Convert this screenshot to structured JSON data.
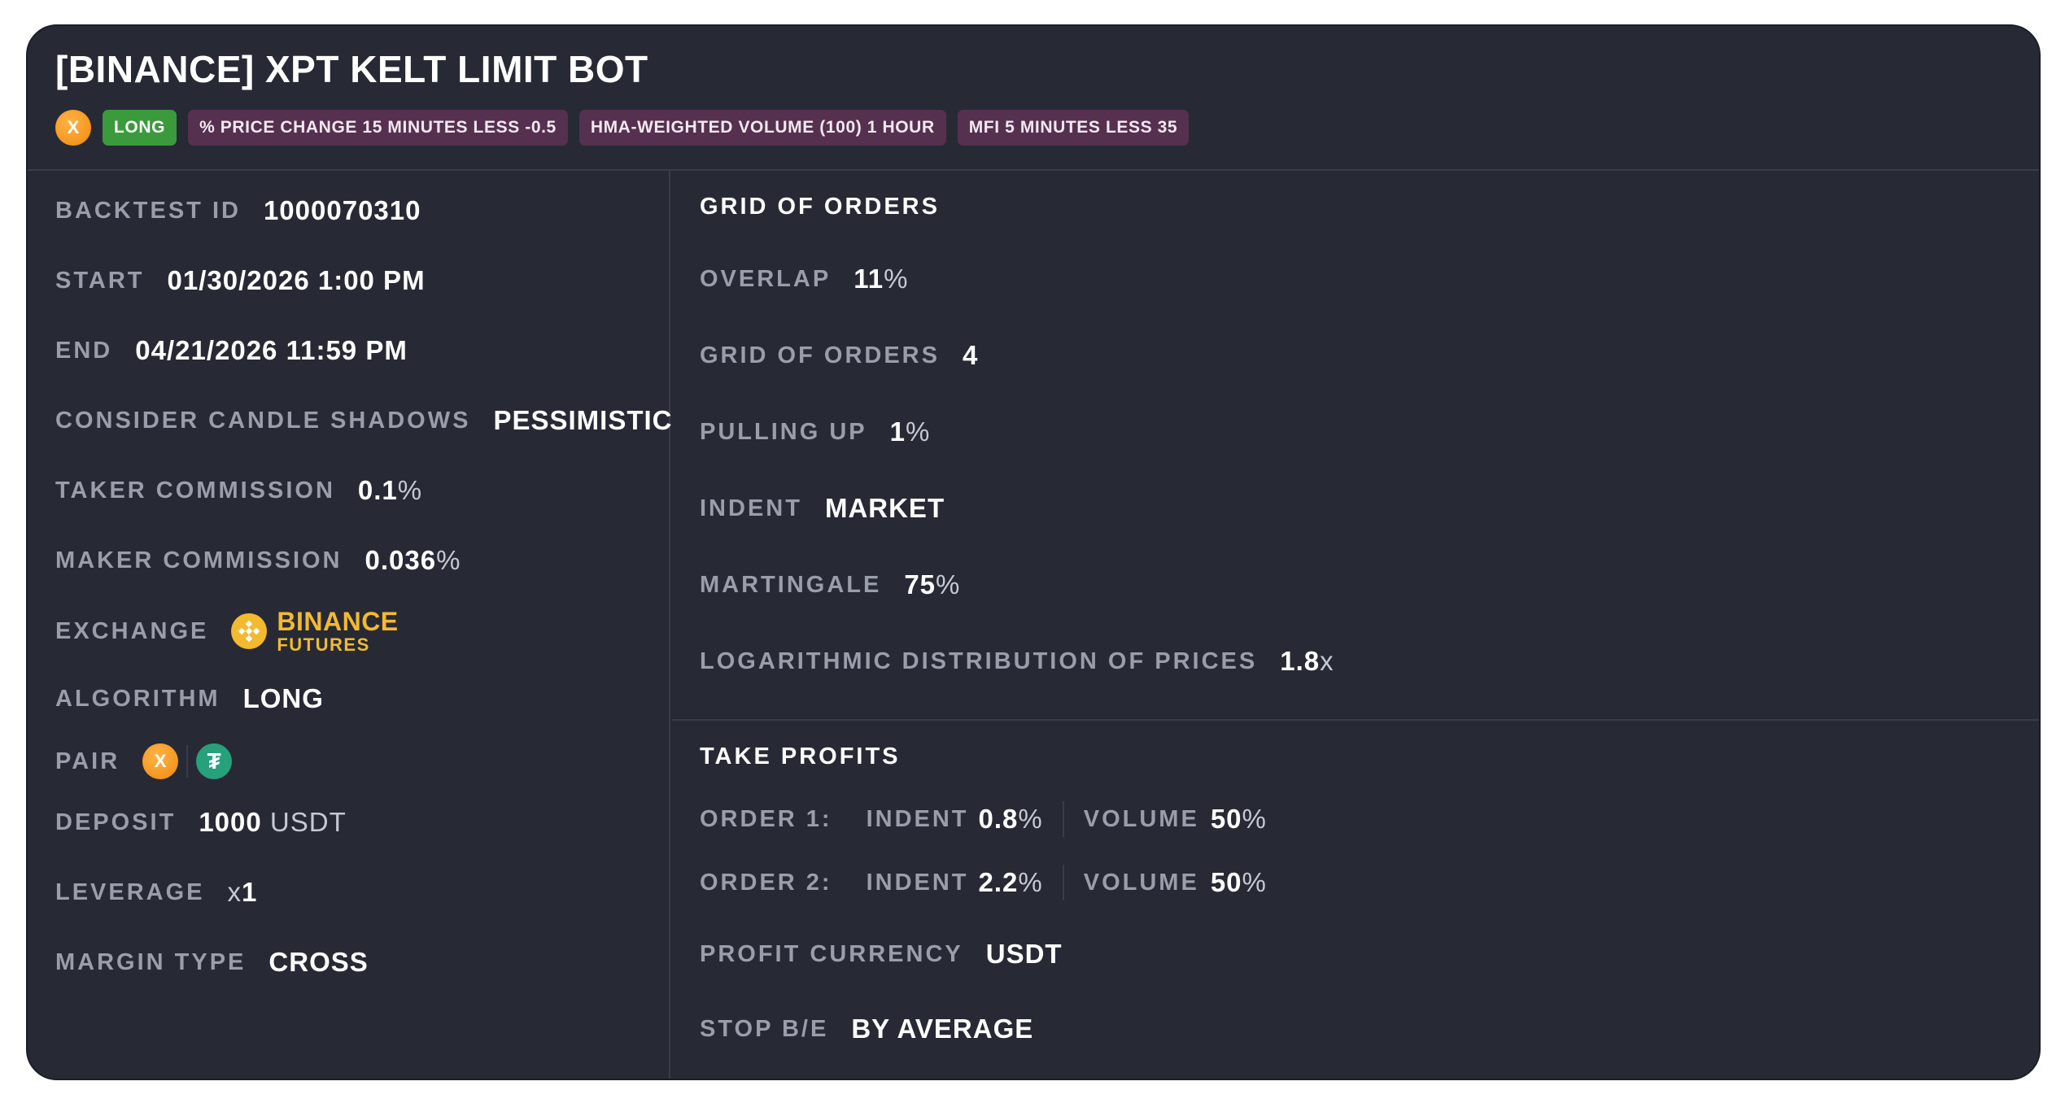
{
  "header": {
    "title": "[BINANCE] XPT KELT LIMIT BOT",
    "coin_letter": "X",
    "tags": [
      {
        "label": "LONG",
        "color": "#3a9a3c"
      },
      {
        "label": "% PRICE CHANGE 15 MINUTES LESS -0.5",
        "color": "#56304f"
      },
      {
        "label": "HMA-WEIGHTED VOLUME (100) 1 HOUR",
        "color": "#56304f"
      },
      {
        "label": "MFI 5 MINUTES LESS 35",
        "color": "#56304f"
      }
    ]
  },
  "details": {
    "backtest_id": {
      "label": "BACKTEST ID",
      "value": "1000070310"
    },
    "start": {
      "label": "START",
      "value": "01/30/2026 1:00 PM"
    },
    "end": {
      "label": "END",
      "value": "04/21/2026 11:59 PM"
    },
    "candle_shadows": {
      "label": "CONSIDER CANDLE SHADOWS",
      "value": "PESSIMISTIC"
    },
    "taker_commission": {
      "label": "TAKER COMMISSION",
      "value": "0.1",
      "unit": "%"
    },
    "maker_commission": {
      "label": "MAKER COMMISSION",
      "value": "0.036",
      "unit": "%"
    },
    "exchange": {
      "label": "EXCHANGE",
      "name": "BINANCE",
      "sub": "FUTURES",
      "icon": "binance-icon"
    },
    "algorithm": {
      "label": "ALGORITHM",
      "value": "LONG"
    },
    "pair": {
      "label": "PAIR",
      "base_letter": "X",
      "quote_icon": "tether-icon"
    },
    "deposit": {
      "label": "DEPOSIT",
      "value": "1000",
      "unit": "USDT"
    },
    "leverage": {
      "label": "LEVERAGE",
      "prefix": "x",
      "value": "1"
    },
    "margin_type": {
      "label": "MARGIN TYPE",
      "value": "CROSS"
    }
  },
  "grid": {
    "section_title": "GRID OF ORDERS",
    "overlap": {
      "label": "OVERLAP",
      "value": "11",
      "unit": "%"
    },
    "grid_orders": {
      "label": "GRID OF ORDERS",
      "value": "4"
    },
    "pulling_up": {
      "label": "PULLING UP",
      "value": "1",
      "unit": "%"
    },
    "indent": {
      "label": "INDENT",
      "value": "MARKET"
    },
    "martingale": {
      "label": "MARTINGALE",
      "value": "75",
      "unit": "%"
    },
    "log_dist": {
      "label": "LOGARITHMIC DISTRIBUTION OF PRICES",
      "value": "1.8",
      "unit": "x"
    }
  },
  "take_profits": {
    "section_title": "TAKE PROFITS",
    "orders": [
      {
        "label": "ORDER 1:",
        "indent_label": "INDENT",
        "indent_value": "0.8",
        "indent_unit": "%",
        "volume_label": "VOLUME",
        "volume_value": "50",
        "volume_unit": "%"
      },
      {
        "label": "ORDER 2:",
        "indent_label": "INDENT",
        "indent_value": "2.2",
        "indent_unit": "%",
        "volume_label": "VOLUME",
        "volume_value": "50",
        "volume_unit": "%"
      }
    ],
    "profit_currency": {
      "label": "PROFIT CURRENCY",
      "value": "USDT"
    },
    "stop_be": {
      "label": "STOP B/E",
      "value": "BY AVERAGE"
    }
  }
}
